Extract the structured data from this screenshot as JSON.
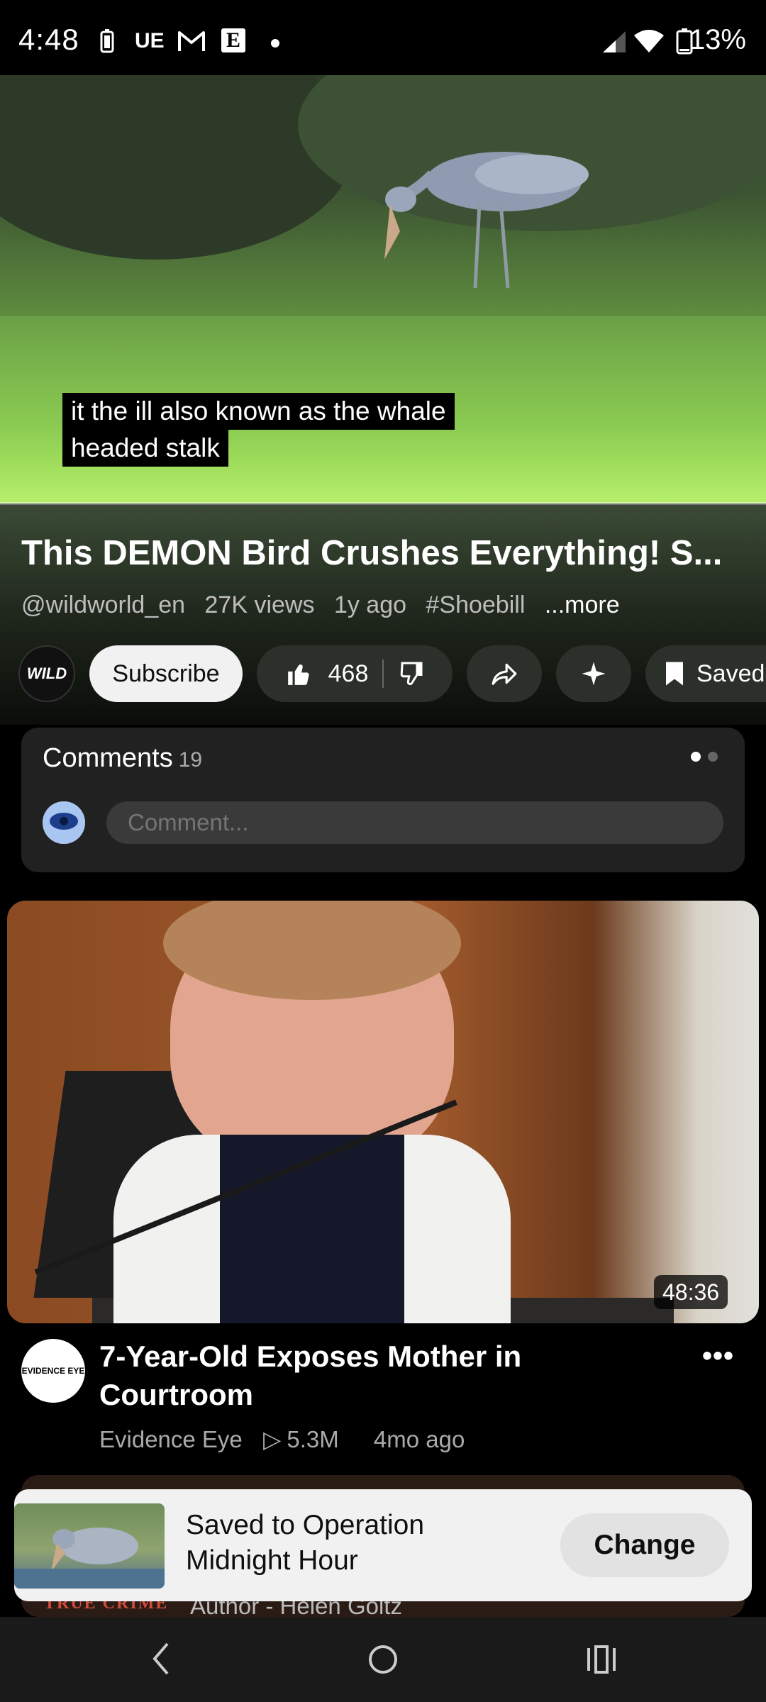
{
  "status_bar": {
    "time": "4:48",
    "notif_icons": [
      "battery-saver-icon",
      "ue-icon",
      "gmail-icon",
      "e-icon",
      "dot-icon"
    ],
    "notif_ue": "UE",
    "notif_e": "E",
    "battery_pct": "13%"
  },
  "video": {
    "caption_line1": "it the ill also known as the whale",
    "caption_line2": "headed stalk",
    "title": "This DEMON Bird Crushes Everything! S...",
    "channel_handle": "@wildworld_en",
    "views": "27K views",
    "age": "1y ago",
    "hashtag": "#Shoebill",
    "more": "...more"
  },
  "actions": {
    "channel_avatar_text": "WILD",
    "subscribe_label": "Subscribe",
    "like_count": "468",
    "save_label": "Saved"
  },
  "comments": {
    "label": "Comments",
    "count": "19",
    "input_placeholder": "Comment..."
  },
  "recommended": {
    "duration": "48:36",
    "channel_avatar_text": "EVIDENCE EYE",
    "title": "7-Year-Old Exposes Mother in Courtroom",
    "channel": "Evidence Eye",
    "views": "5.3M",
    "age": "4mo ago"
  },
  "next_item": {
    "thumb_text": "TRUE CRIME",
    "author": "Author - Helen Goltz"
  },
  "snackbar": {
    "message": "Saved to Operation Midnight Hour",
    "change_label": "Change"
  },
  "colors": {
    "background": "#000000",
    "pill": "#2c302a",
    "snackbar": "#f1f1f1"
  }
}
